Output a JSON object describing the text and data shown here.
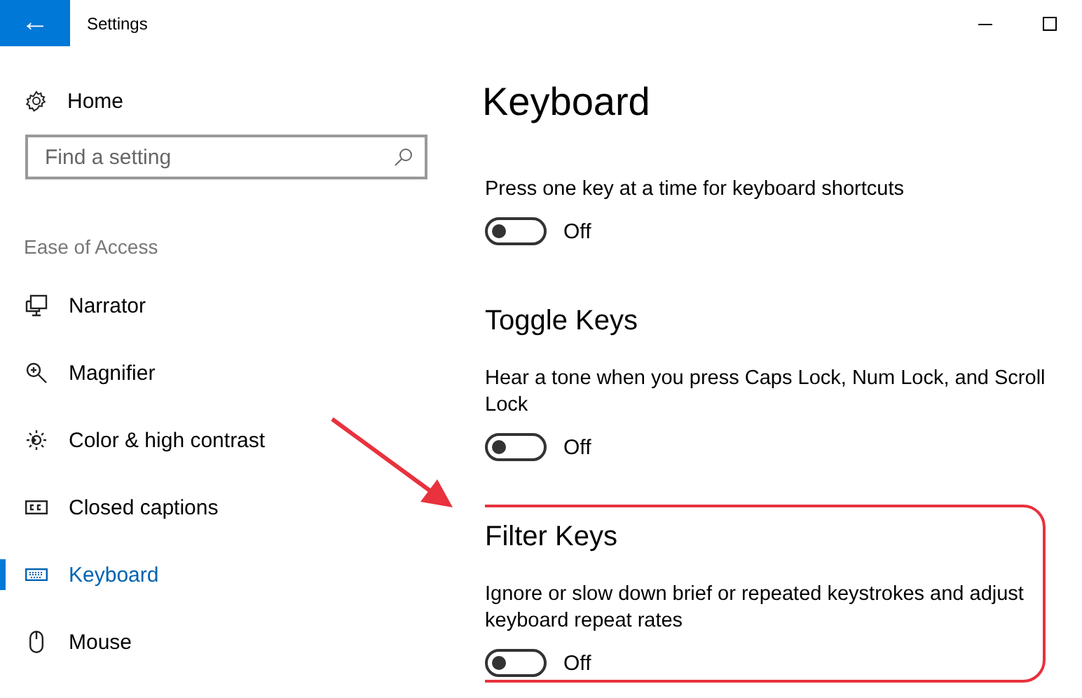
{
  "window": {
    "title": "Settings",
    "back": "←"
  },
  "sidebar": {
    "home": "Home",
    "search": {
      "placeholder": "Find a setting"
    },
    "group": "Ease of Access",
    "items": [
      {
        "label": "Narrator",
        "kind": "narrator",
        "selected": false
      },
      {
        "label": "Magnifier",
        "kind": "magnifier",
        "selected": false
      },
      {
        "label": "Color & high contrast",
        "kind": "brightness",
        "selected": false
      },
      {
        "label": "Closed captions",
        "kind": "captions",
        "selected": false
      },
      {
        "label": "Keyboard",
        "kind": "keyboard",
        "selected": true
      },
      {
        "label": "Mouse",
        "kind": "mouse",
        "selected": false
      }
    ]
  },
  "page": {
    "title": "Keyboard",
    "sections": [
      {
        "description": "Press one key at a time for keyboard shortcuts",
        "on": false,
        "state": "Off",
        "highlighted": false
      },
      {
        "heading": "Toggle Keys",
        "description": "Hear a tone when you press Caps Lock, Num Lock, and Scroll Lock",
        "on": false,
        "state": "Off",
        "highlighted": false
      },
      {
        "heading": "Filter Keys",
        "description": "Ignore or slow down brief or repeated keystrokes and adjust keyboard repeat rates",
        "on": false,
        "state": "Off",
        "highlighted": true
      }
    ]
  }
}
